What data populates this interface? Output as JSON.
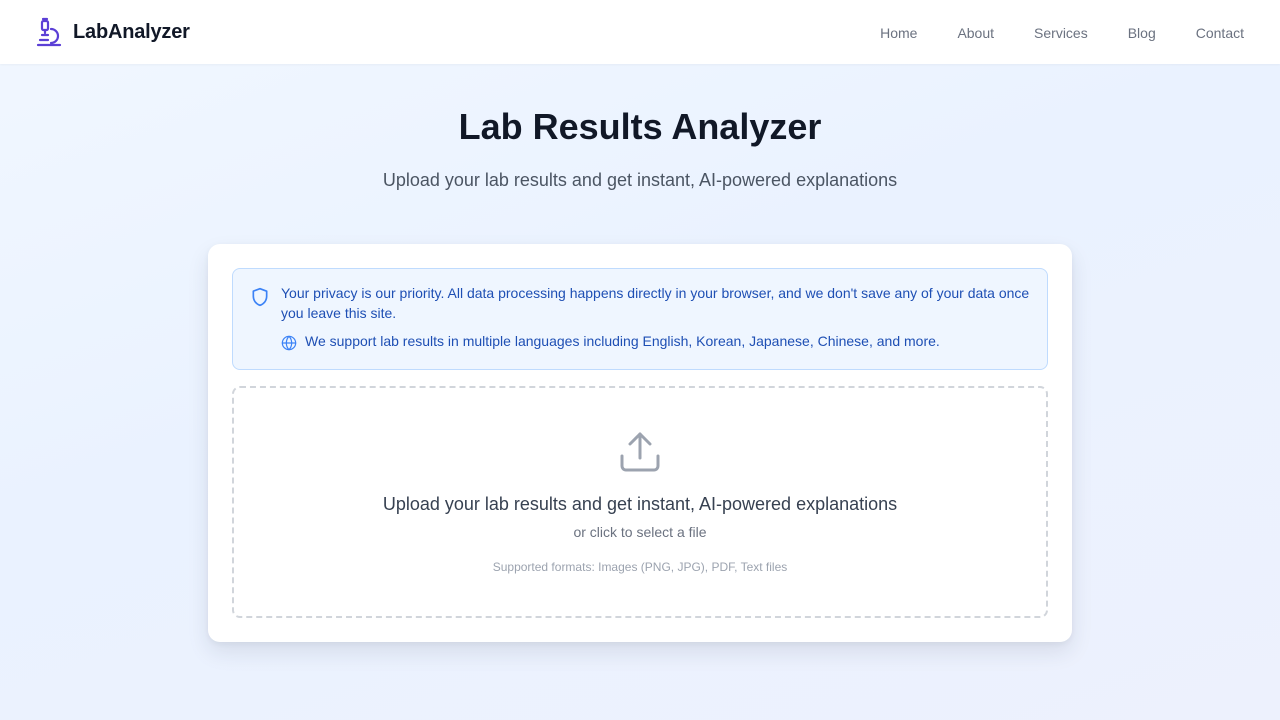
{
  "header": {
    "brand": "LabAnalyzer",
    "brand_icon": "microscope-icon",
    "brand_color": "#5b3fd6",
    "nav": [
      {
        "label": "Home"
      },
      {
        "label": "About"
      },
      {
        "label": "Services"
      },
      {
        "label": "Blog"
      },
      {
        "label": "Contact"
      }
    ]
  },
  "hero": {
    "title": "Lab Results Analyzer",
    "subtitle": "Upload your lab results and get instant, AI-powered explanations"
  },
  "notice": {
    "privacy_icon": "shield-icon",
    "privacy_text": "Your privacy is our priority. All data processing happens directly in your browser, and we don't save any of your data once you leave this site.",
    "language_icon": "globe-icon",
    "language_text": "We support lab results in multiple languages including English, Korean, Japanese, Chinese, and more.",
    "accent_color": "#2563eb",
    "background_color": "#eff6ff"
  },
  "upload": {
    "icon": "upload-icon",
    "title": "Upload your lab results and get instant, AI-powered explanations",
    "subtitle": "or click to select a file",
    "formats": "Supported formats: Images (PNG, JPG), PDF, Text files"
  }
}
